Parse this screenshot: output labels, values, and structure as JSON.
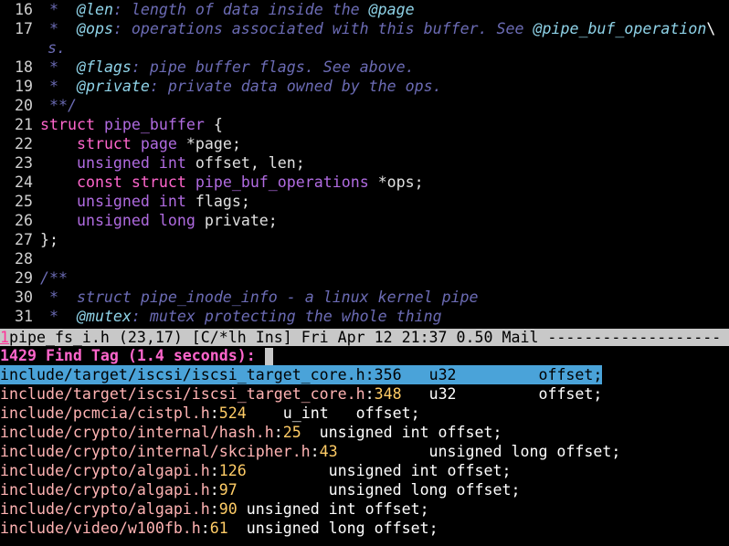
{
  "code": {
    "l16": {
      "n": "16",
      "pre": " *  ",
      "tag": "@len",
      "rest": ": length of data inside the ",
      "tag2": "@page"
    },
    "l17": {
      "n": "17",
      "pre": " *  ",
      "tag": "@ops",
      "rest": ": operations associated with this buffer. See ",
      "tag2": "@pipe_buf_operation",
      "bs": "\\"
    },
    "l17b": {
      "wrap": "s."
    },
    "l18": {
      "n": "18",
      "pre": " *  ",
      "tag": "@flags",
      "rest": ": pipe buffer flags. See above."
    },
    "l19": {
      "n": "19",
      "pre": " *  ",
      "tag": "@private",
      "rest": ": private data owned by the ops."
    },
    "l20": {
      "n": "20",
      "text": " **/"
    },
    "l21": {
      "n": "21",
      "kw": "struct",
      "sp": " ",
      "ty": "pipe_buffer",
      "rest": " {"
    },
    "l22": {
      "n": "22",
      "indent": "    ",
      "kw": "struct",
      "sp": " ",
      "ty": "page",
      "rest": " *page;"
    },
    "l23": {
      "n": "23",
      "indent": "    ",
      "ty1": "unsigned",
      "sp": " ",
      "ty2": "int",
      "rest": " offset, len;"
    },
    "l24": {
      "n": "24",
      "indent": "    ",
      "kw1": "const",
      "sp1": " ",
      "kw2": "struct",
      "sp2": " ",
      "ty": "pipe_buf_operations",
      "rest": " *ops;"
    },
    "l25": {
      "n": "25",
      "indent": "    ",
      "ty1": "unsigned",
      "sp": " ",
      "ty2": "int",
      "rest": " flags;"
    },
    "l26": {
      "n": "26",
      "indent": "    ",
      "ty1": "unsigned",
      "sp": " ",
      "ty2": "long",
      "rest": " private;"
    },
    "l27": {
      "n": "27",
      "text": "};"
    },
    "l28": {
      "n": "28",
      "text": ""
    },
    "l29": {
      "n": "29",
      "text": "/**"
    },
    "l30": {
      "n": "30",
      "text": " *  struct pipe_inode_info - a linux kernel pipe"
    },
    "l31": {
      "n": "31",
      "pre": " *  ",
      "tag": "@mutex",
      "rest": ": mutex protecting the whole thing"
    }
  },
  "status": {
    "window_num": "1",
    "text": "pipe_fs_i.h (23,17) [C/*lh Ins] Fri Apr 12 21:37 0.50 Mail -------------------"
  },
  "find": {
    "header": "1429 Find Tag (1.4 seconds):",
    "results": [
      {
        "path": "include/target/iscsi/iscsi_target_core.h",
        "line": "356",
        "body": ":   u32         offset;"
      },
      {
        "path": "include/target/iscsi/iscsi_target_core.h",
        "line": "348",
        "body": ":   u32         offset;"
      },
      {
        "path": "include/pcmcia/cistpl.h",
        "line": "524",
        "body": ":    u_int   offset;"
      },
      {
        "path": "include/crypto/internal/hash.h",
        "line": "25",
        "body": ":  unsigned int offset;"
      },
      {
        "path": "include/crypto/internal/skcipher.h",
        "line": "43",
        "body": ":          unsigned long offset;"
      },
      {
        "path": "include/crypto/algapi.h",
        "line": "126",
        "body": ":         unsigned int offset;"
      },
      {
        "path": "include/crypto/algapi.h",
        "line": "97",
        "body": ":          unsigned long offset;"
      },
      {
        "path": "include/crypto/algapi.h",
        "line": "90",
        "body": ": unsigned int offset;"
      },
      {
        "path": "include/video/w100fb.h",
        "line": "61",
        "body": ":  unsigned long offset;"
      }
    ]
  },
  "colors": {
    "comment": "#6b6bb4",
    "keyword": "#ff66cc",
    "type": "#b06be0",
    "tag": "#8fd3e8",
    "selection": "#4aa3d9",
    "statusbar": "#c8c8c8"
  }
}
